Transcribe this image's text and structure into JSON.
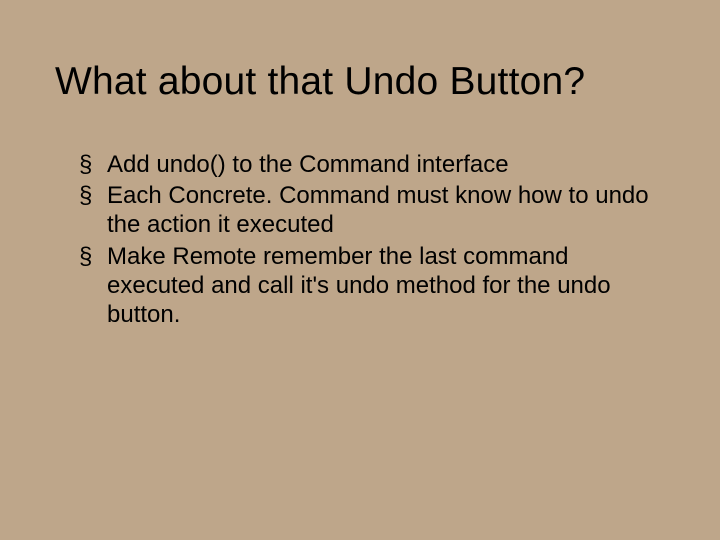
{
  "title": "What about that Undo Button?",
  "bullets": [
    "Add undo() to the Command interface",
    "Each Concrete. Command must know how to undo the action it executed",
    "Make Remote remember the last command executed and call it's undo method for the undo button."
  ]
}
